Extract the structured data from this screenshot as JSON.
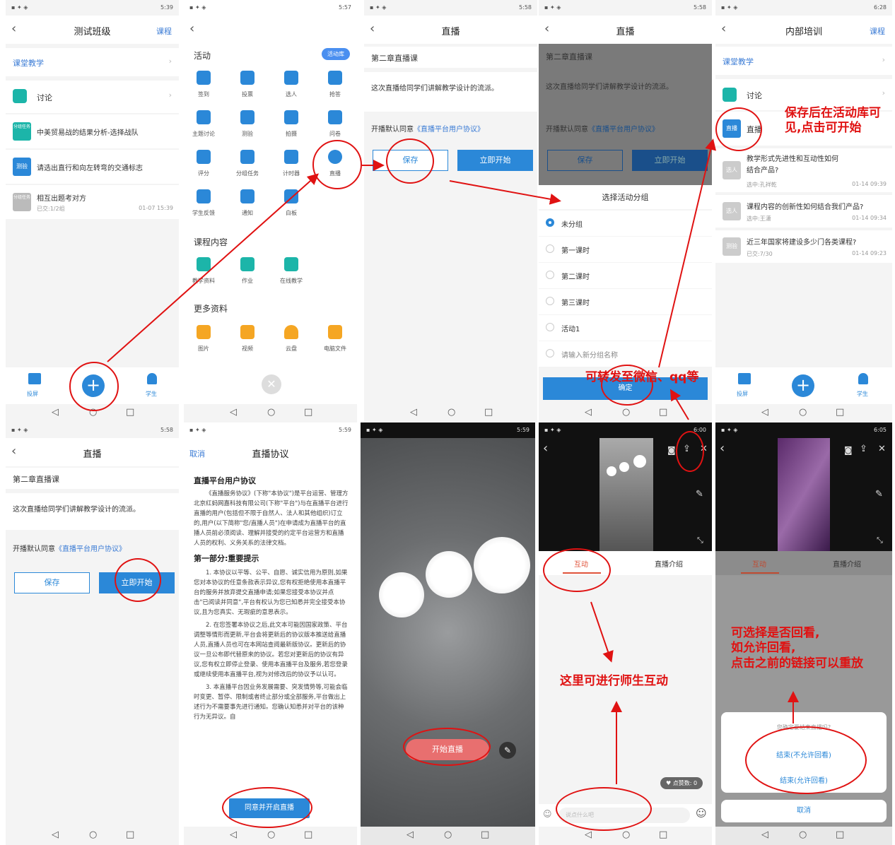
{
  "status": {
    "p1_time": "5:39",
    "p2_time": "5:57",
    "p3_time": "5:58",
    "p4_time": "5:58",
    "p5_time": "6:28",
    "p6_time": "5:58",
    "p7_time": "5:59",
    "p8_time": "5:59",
    "p9_time": "6:00",
    "p10_time": "6:05"
  },
  "p1": {
    "title": "测试班级",
    "action": "课程",
    "section": "课堂教学",
    "items": [
      {
        "name": "讨论"
      },
      {
        "tag": "分组任务",
        "name": "中美贸易战的结果分析-选择战队"
      },
      {
        "tag": "测验",
        "name": "请选出直行和向左转弯的交通标志"
      },
      {
        "tag": "分组任务",
        "name": "相互出题考对方",
        "sub": "已交:1/2组",
        "time": "01-07 15:39"
      }
    ],
    "nav": [
      "投屏",
      "学生"
    ]
  },
  "p2": {
    "sec1": "活动",
    "badge": "活动库",
    "activities": [
      "签到",
      "投票",
      "选人",
      "抢答",
      "主题讨论",
      "测验",
      "拍摄",
      "问卷",
      "评分",
      "分组任务",
      "计时器",
      "直播",
      "学生反馈",
      "通知",
      "白板"
    ],
    "sec2": "课程内容",
    "content": [
      "教学资料",
      "作业",
      "在线教学"
    ],
    "sec3": "更多资料",
    "more": [
      "图片",
      "视频",
      "云盘",
      "电脑文件"
    ]
  },
  "live": {
    "title": "直播",
    "chapter": "第二章直播课",
    "desc": "这次直播给同学们讲解教学设计的流派。",
    "agree_prefix": "开播默认同意",
    "agree_link": "《直播平台用户协议》",
    "save": "保存",
    "start": "立即开始"
  },
  "p4": {
    "sheet_title": "选择活动分组",
    "groups": [
      "未分组",
      "第一课时",
      "第二课时",
      "第三课时",
      "活动1",
      "请输入新分组名称"
    ],
    "confirm": "确定"
  },
  "p5": {
    "title": "内部培训",
    "action": "课程",
    "section": "课堂教学",
    "items": [
      {
        "name": "讨论"
      },
      {
        "tag": "直播",
        "name": "直播"
      },
      {
        "tag": "选人",
        "name": "教学形式先进性和互动性如何结合产品?",
        "sub": "选中:孔祥乾",
        "time": "01-14 09:39"
      },
      {
        "tag": "选人",
        "name": "课程内容的创新性如何结合我们产品?",
        "sub": "选中:王潇",
        "time": "01-14 09:34"
      },
      {
        "tag": "测验",
        "name": "近三年国家将建设多少门各类课程?",
        "sub": "已交:7/30",
        "time": "01-14 09:23"
      }
    ],
    "nav": [
      "投屏",
      "学生"
    ]
  },
  "p7": {
    "cancel": "取消",
    "title": "直播协议",
    "h1": "直播平台用户协议",
    "para1": "《直播服务协议》(下称\"本协议\")是平台运营、管理方北京红蚂网嘉科技有限公司(下称\"平台\")与在直播平台进行直播的用户(包括但不限于自然人、法人和其他组织)订立的,用户(以下简称\"您/直播人员\")在申请成为直播平台的直播人员前必须阅读、理解并接受的约定平台运营方和直播人员的权利、义务关系的法律文档。",
    "h2": "第一部分:重要提示",
    "para2": "1. 本协议以平等、公平、自愿、诚实信用为原则,如果您对本协议的任意条款表示异议,您有权拒绝使用本直播平台的服务并放弃提交直播申请;如果您接受本协议并点击\"已阅读并同意\",平台有权认为您已知悉并完全接受本协议,且为您真实、无瑕疵的意思表示。",
    "para3": "2. 在您签署本协议之后,此文本可能因国家政策、平台调整等情形而更新,平台会将更新后的协议版本推送给直播人员,直播人员也可在本网站查阅最新版协议。更新后的协议一旦公布即代替原来的协议。若您对更新后的协议有异议,您有权立即停止登录、使用本直播平台及服务,若您登录或继续使用本直播平台,视为对修改后的协议予以认可。",
    "para4": "3. 本直播平台因业务发展需要、突发情势等,可能会临时变更、暂停、限制或者终止部分或全部服务,平台做出上述行为不需要事先进行通知。您确认知悉并对平台的该种行为无异议。自",
    "agree_btn": "同意并开启直播"
  },
  "p8": {
    "start_btn": "开始直播"
  },
  "p9": {
    "tab1": "互动",
    "tab2": "直播介绍",
    "likes": "点赞数: 0",
    "input": "说点什么吧"
  },
  "p10": {
    "tab1": "互动",
    "tab2": "直播介绍",
    "dialog_q": "您确定要结束直播吗?",
    "opt1": "结束(不允许回看)",
    "opt2": "结束(允许回看)",
    "cancel": "取消"
  },
  "notes": {
    "n1": "保存后在活动库可见,点击可开始",
    "n2": "可转发至微信、qq等",
    "n3": "这里可进行师生互动",
    "n4a": "可选择是否回看,",
    "n4b": "如允许回看,",
    "n4c": "点击之前的链接可以重放"
  },
  "colors": {
    "accent": "#2b88d8",
    "annotation": "#e01212",
    "teal": "#1cb5a9",
    "orange": "#f5a623"
  }
}
